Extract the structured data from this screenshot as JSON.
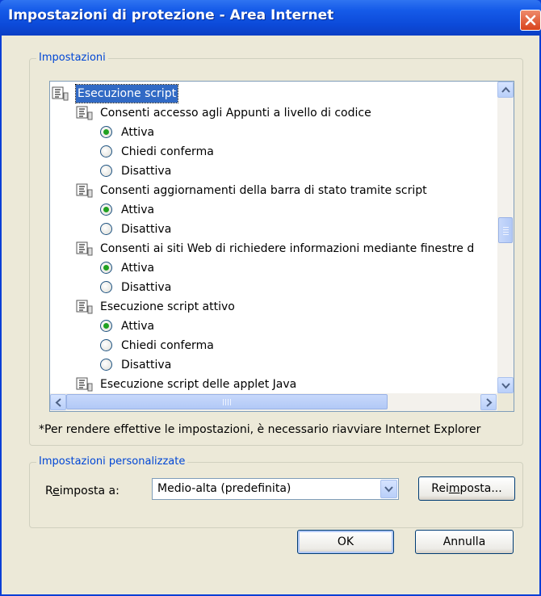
{
  "window": {
    "title": "Impostazioni di protezione - Area Internet"
  },
  "settings": {
    "group_label": "Impostazioni",
    "category": "Esecuzione script",
    "items": [
      {
        "label": "Consenti accesso agli Appunti a livello di codice",
        "options": [
          "Attiva",
          "Chiedi conferma",
          "Disattiva"
        ],
        "selected": "Attiva"
      },
      {
        "label": "Consenti aggiornamenti della barra di stato tramite script",
        "options": [
          "Attiva",
          "Disattiva"
        ],
        "selected": "Attiva"
      },
      {
        "label": "Consenti ai siti Web di richiedere informazioni mediante finestre d",
        "options": [
          "Attiva",
          "Disattiva"
        ],
        "selected": "Attiva"
      },
      {
        "label": "Esecuzione script attivo",
        "options": [
          "Attiva",
          "Chiedi conferma",
          "Disattiva"
        ],
        "selected": "Attiva"
      },
      {
        "label": "Esecuzione script delle applet Java"
      }
    ],
    "note": "*Per rendere effettive le impostazioni, è necessario riavviare Internet Explorer"
  },
  "custom": {
    "group_label": "Impostazioni personalizzate",
    "reset_label_pre": "R",
    "reset_label_acc": "e",
    "reset_label_post": "imposta a:",
    "select_value": "Medio-alta (predefinita)",
    "reset_button_pre": "Rei",
    "reset_button_acc": "m",
    "reset_button_post": "posta..."
  },
  "buttons": {
    "ok": "OK",
    "cancel": "Annulla"
  },
  "colors": {
    "titlebar": "#0c4ad9",
    "dialog_bg": "#ece9d8",
    "group_label": "#0046d5",
    "selection": "#316ac5",
    "radio_checked": "#21a121",
    "close_button": "#d8431c"
  }
}
